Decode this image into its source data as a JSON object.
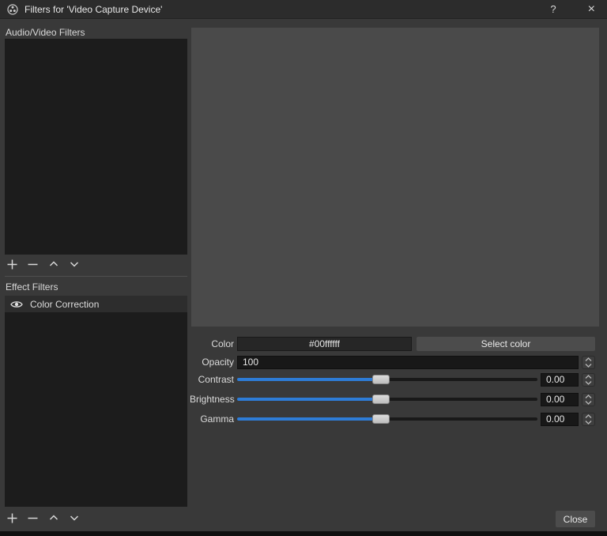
{
  "titlebar": {
    "title": "Filters for 'Video Capture Device'",
    "help": "?",
    "close": "×"
  },
  "left_panel": {
    "audio_video_header": "Audio/Video Filters",
    "effect_header": "Effect Filters",
    "effect_filters": [
      {
        "name": "Color Correction",
        "visible": true
      }
    ]
  },
  "controls": {
    "color": {
      "label": "Color",
      "value": "#00ffffff",
      "select_button": "Select color"
    },
    "opacity": {
      "label": "Opacity",
      "value": "100"
    },
    "contrast": {
      "label": "Contrast",
      "value": "0.00",
      "slider_percent": 48
    },
    "brightness": {
      "label": "Brightness",
      "value": "0.00",
      "slider_percent": 48
    },
    "gamma": {
      "label": "Gamma",
      "value": "0.00",
      "slider_percent": 48
    }
  },
  "footer": {
    "close_button": "Close"
  },
  "colors": {
    "accent_blue": "#2e7cd6",
    "titlebar_bg": "#2c2c2c",
    "dialog_bg": "#393939",
    "list_bg": "#1c1c1c",
    "preview_bg": "#4a4a4a",
    "selected_row_bg": "#2d2d2d"
  }
}
